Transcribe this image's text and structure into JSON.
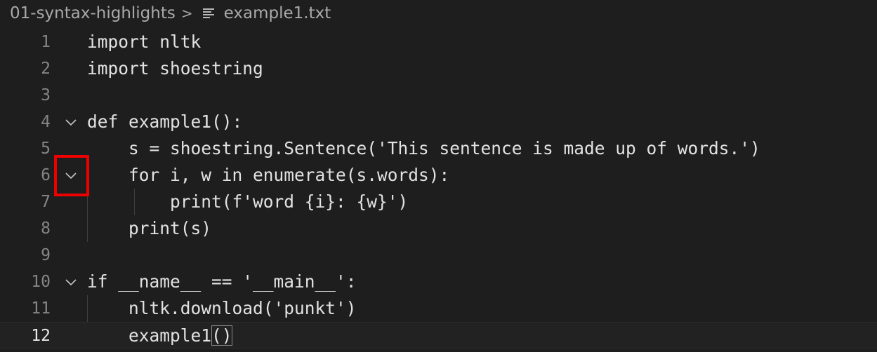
{
  "breadcrumb": {
    "folder": "01-syntax-highlights",
    "separator": ">",
    "file": "example1.txt",
    "file_icon": "text-lines-icon"
  },
  "editor": {
    "lines": [
      {
        "number": "1",
        "text": "import nltk"
      },
      {
        "number": "2",
        "text": "import shoestring"
      },
      {
        "number": "3",
        "text": ""
      },
      {
        "number": "4",
        "text": "def example1():",
        "fold": "chevron-down-icon"
      },
      {
        "number": "5",
        "text": "    s = shoestring.Sentence('This sentence is made up of words.')"
      },
      {
        "number": "6",
        "text": "    for i, w in enumerate(s.words):",
        "fold": "chevron-down-icon"
      },
      {
        "number": "7",
        "text": "        print(f'word {i}: {w}')"
      },
      {
        "number": "8",
        "text": "    print(s)"
      },
      {
        "number": "9",
        "text": ""
      },
      {
        "number": "10",
        "text": "if __name__ == '__main__':",
        "fold": "chevron-down-icon"
      },
      {
        "number": "11",
        "text": "    nltk.download('punkt')"
      },
      {
        "number": "12",
        "text_before": "    example1",
        "text_bracket": "()",
        "current": true
      }
    ]
  },
  "annotation": {
    "color": "#ee0000",
    "target": "fold-toggle-line-6"
  }
}
